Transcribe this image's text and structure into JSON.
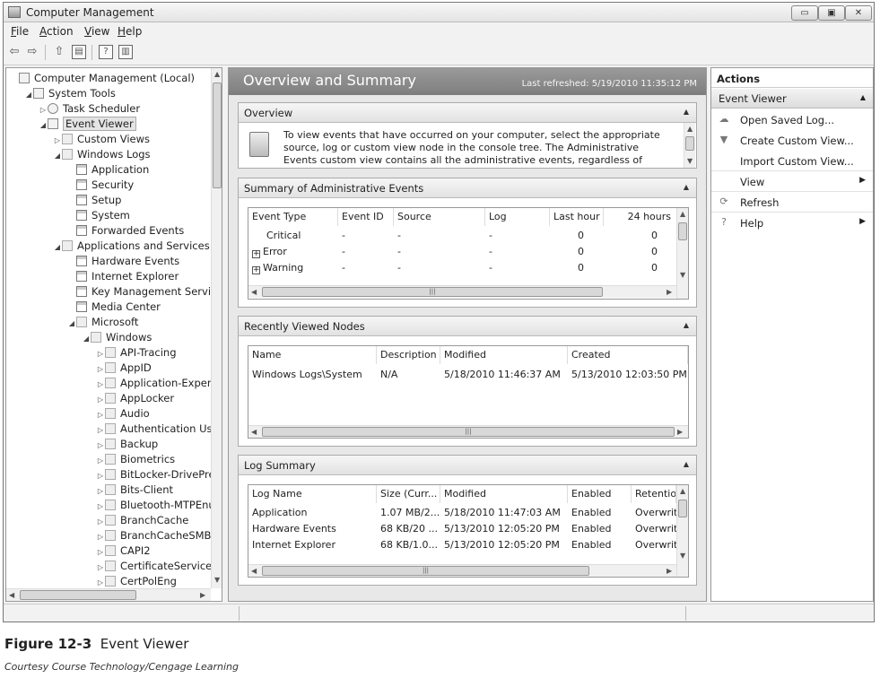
{
  "window": {
    "title": "Computer Management",
    "controls": {
      "minimize": "▭",
      "maximize": "▣",
      "close": "✕"
    }
  },
  "menu": [
    {
      "accel": "F",
      "rest": "ile"
    },
    {
      "accel": "A",
      "rest": "ction"
    },
    {
      "accel": "V",
      "rest": "iew"
    },
    {
      "accel": "H",
      "rest": "elp"
    }
  ],
  "toolbar_icons": [
    "back-arrow-icon",
    "forward-arrow-icon",
    "up-folder-icon",
    "show-hide-tree-icon",
    "help-icon",
    "properties-icon"
  ],
  "tree": {
    "items": [
      {
        "label": "Computer Management (Local)",
        "level": 0,
        "arrow": "",
        "icon": "computer-icon"
      },
      {
        "label": "System Tools",
        "level": 1,
        "arrow": "◢",
        "icon": "tools-icon"
      },
      {
        "label": "Task Scheduler",
        "level": 2,
        "arrow": "▷",
        "icon": "clock-icon"
      },
      {
        "label": "Event Viewer",
        "level": 2,
        "arrow": "◢",
        "icon": "event-viewer-icon",
        "selected": true
      },
      {
        "label": "Custom Views",
        "level": 3,
        "arrow": "▷",
        "icon": "folder-icon"
      },
      {
        "label": "Windows Logs",
        "level": 3,
        "arrow": "◢",
        "icon": "folder-icon"
      },
      {
        "label": "Application",
        "level": 4,
        "arrow": "",
        "icon": "log-icon"
      },
      {
        "label": "Security",
        "level": 4,
        "arrow": "",
        "icon": "log-icon"
      },
      {
        "label": "Setup",
        "level": 4,
        "arrow": "",
        "icon": "log-icon"
      },
      {
        "label": "System",
        "level": 4,
        "arrow": "",
        "icon": "log-icon"
      },
      {
        "label": "Forwarded Events",
        "level": 4,
        "arrow": "",
        "icon": "log-icon"
      },
      {
        "label": "Applications and Services Log",
        "level": 3,
        "arrow": "◢",
        "icon": "folder-icon"
      },
      {
        "label": "Hardware Events",
        "level": 4,
        "arrow": "",
        "icon": "log-icon"
      },
      {
        "label": "Internet Explorer",
        "level": 4,
        "arrow": "",
        "icon": "log-icon"
      },
      {
        "label": "Key Management Service",
        "level": 4,
        "arrow": "",
        "icon": "log-icon"
      },
      {
        "label": "Media Center",
        "level": 4,
        "arrow": "",
        "icon": "log-icon"
      },
      {
        "label": "Microsoft",
        "level": 4,
        "arrow": "◢",
        "icon": "folder-icon"
      },
      {
        "label": "Windows",
        "level": 5,
        "arrow": "◢",
        "icon": "folder-icon"
      },
      {
        "label": "API-Tracing",
        "level": 6,
        "arrow": "▷",
        "icon": "folder-icon"
      },
      {
        "label": "AppID",
        "level": 6,
        "arrow": "▷",
        "icon": "folder-icon"
      },
      {
        "label": "Application-Experie",
        "level": 6,
        "arrow": "▷",
        "icon": "folder-icon"
      },
      {
        "label": "AppLocker",
        "level": 6,
        "arrow": "▷",
        "icon": "folder-icon"
      },
      {
        "label": "Audio",
        "level": 6,
        "arrow": "▷",
        "icon": "folder-icon"
      },
      {
        "label": "Authentication Use",
        "level": 6,
        "arrow": "▷",
        "icon": "folder-icon"
      },
      {
        "label": "Backup",
        "level": 6,
        "arrow": "▷",
        "icon": "folder-icon"
      },
      {
        "label": "Biometrics",
        "level": 6,
        "arrow": "▷",
        "icon": "folder-icon"
      },
      {
        "label": "BitLocker-DrivePre",
        "level": 6,
        "arrow": "▷",
        "icon": "folder-icon"
      },
      {
        "label": "Bits-Client",
        "level": 6,
        "arrow": "▷",
        "icon": "folder-icon"
      },
      {
        "label": "Bluetooth-MTPEnu",
        "level": 6,
        "arrow": "▷",
        "icon": "folder-icon"
      },
      {
        "label": "BranchCache",
        "level": 6,
        "arrow": "▷",
        "icon": "folder-icon"
      },
      {
        "label": "BranchCacheSMB",
        "level": 6,
        "arrow": "▷",
        "icon": "folder-icon"
      },
      {
        "label": "CAPI2",
        "level": 6,
        "arrow": "▷",
        "icon": "folder-icon"
      },
      {
        "label": "CertificateServices",
        "level": 6,
        "arrow": "▷",
        "icon": "folder-icon"
      },
      {
        "label": "CertPolEng",
        "level": 6,
        "arrow": "▷",
        "icon": "folder-icon"
      }
    ]
  },
  "middle": {
    "title": "Overview and Summary",
    "last_refreshed": "Last refreshed: 5/19/2010 11:35:12 PM",
    "overview": {
      "header": "Overview",
      "text": "To view events that have occurred on your computer, select the appropriate source, log or custom view node in the console tree. The Administrative Events custom view contains all the administrative events, regardless of source. An aggregate view of all"
    },
    "summary": {
      "header": "Summary of Administrative Events",
      "columns": [
        "Event Type",
        "Event ID",
        "Source",
        "Log",
        "Last hour",
        "24 hours"
      ],
      "rows": [
        {
          "expand": false,
          "cells": [
            "Critical",
            "-",
            "-",
            "-",
            "0",
            "0"
          ]
        },
        {
          "expand": true,
          "cells": [
            "Error",
            "-",
            "-",
            "-",
            "0",
            "0"
          ]
        },
        {
          "expand": true,
          "cells": [
            "Warning",
            "-",
            "-",
            "-",
            "0",
            "0"
          ]
        }
      ]
    },
    "recent": {
      "header": "Recently Viewed Nodes",
      "columns": [
        "Name",
        "Description",
        "Modified",
        "Created"
      ],
      "rows": [
        [
          "Windows Logs\\System",
          "N/A",
          "5/18/2010 11:46:37 AM",
          "5/13/2010 12:03:50 PM"
        ]
      ]
    },
    "log_summary": {
      "header": "Log Summary",
      "columns": [
        "Log Name",
        "Size (Curr...",
        "Modified",
        "Enabled",
        "Retentio"
      ],
      "rows": [
        [
          "Application",
          "1.07 MB/2...",
          "5/18/2010 11:47:03 AM",
          "Enabled",
          "Overwrit"
        ],
        [
          "Hardware Events",
          "68 KB/20 ...",
          "5/13/2010 12:05:20 PM",
          "Enabled",
          "Overwrit"
        ],
        [
          "Internet Explorer",
          "68 KB/1.0...",
          "5/13/2010 12:05:20 PM",
          "Enabled",
          "Overwrit"
        ]
      ]
    }
  },
  "actions": {
    "header": "Actions",
    "group": "Event Viewer",
    "items": [
      {
        "label": "Open Saved Log...",
        "icon": "open-log-icon",
        "glyph": "☁",
        "submenu": false
      },
      {
        "label": "Create Custom View...",
        "icon": "filter-icon",
        "glyph": "▼",
        "submenu": false
      },
      {
        "label": "Import Custom View...",
        "icon": "",
        "glyph": "",
        "submenu": false
      },
      {
        "label": "View",
        "icon": "",
        "glyph": "",
        "submenu": true
      },
      {
        "label": "Refresh",
        "icon": "refresh-icon",
        "glyph": "⟳",
        "submenu": false
      },
      {
        "label": "Help",
        "icon": "help-icon",
        "glyph": "?",
        "submenu": true
      }
    ]
  },
  "caption": {
    "figure": "Figure 12-3",
    "title": "Event Viewer",
    "credit": "Courtesy Course Technology/Cengage Learning"
  }
}
